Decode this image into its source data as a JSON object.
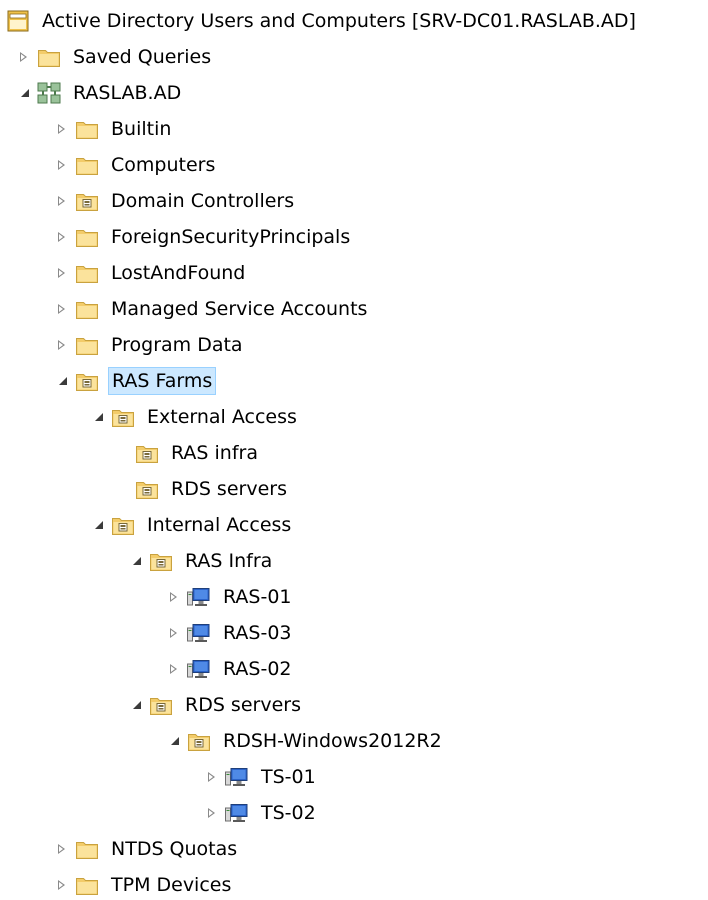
{
  "window": {
    "title": "Active Directory Users and Computers [SRV-DC01.RASLAB.AD]",
    "title_icon": "ad-console-icon"
  },
  "tree": {
    "saved_queries": "Saved Queries",
    "domain": "RASLAB.AD",
    "builtin": "Builtin",
    "computers": "Computers",
    "domain_controllers": "Domain Controllers",
    "fsp": "ForeignSecurityPrincipals",
    "lost_found": "LostAndFound",
    "msa": "Managed Service Accounts",
    "program_data": "Program Data",
    "ras_farms": "RAS Farms",
    "external_access": "External Access",
    "ext_ras_infra": "RAS infra",
    "ext_rds_servers": "RDS servers",
    "internal_access": "Internal Access",
    "int_ras_infra": "RAS Infra",
    "ras01": "RAS-01",
    "ras03": "RAS-03",
    "ras02": "RAS-02",
    "int_rds_servers": "RDS servers",
    "rdsh": "RDSH-Windows2012R2",
    "ts01": "TS-01",
    "ts02": "TS-02",
    "ntds_quotas": "NTDS Quotas",
    "tpm_devices": "TPM Devices"
  },
  "colors": {
    "selection_bg": "#cce8ff",
    "selection_border": "#99d1ff",
    "folder": "#f6d47c"
  }
}
